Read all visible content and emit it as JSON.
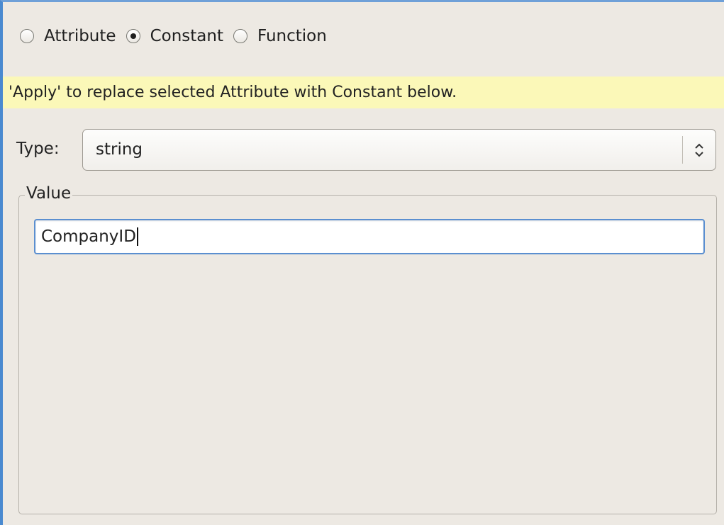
{
  "source_selector": {
    "options": [
      {
        "label": "Attribute",
        "selected": false
      },
      {
        "label": "Constant",
        "selected": true
      },
      {
        "label": "Function",
        "selected": false
      }
    ]
  },
  "hint": {
    "text": "'Apply' to replace selected Attribute with Constant below.",
    "background": "#fbf8b8"
  },
  "type_field": {
    "label": "Type:",
    "selected_value": "string",
    "icon": "updown-chevron-icon"
  },
  "value_group": {
    "legend": "Value",
    "input_value": "CompanyID",
    "focus_color": "#5b8fd0"
  }
}
